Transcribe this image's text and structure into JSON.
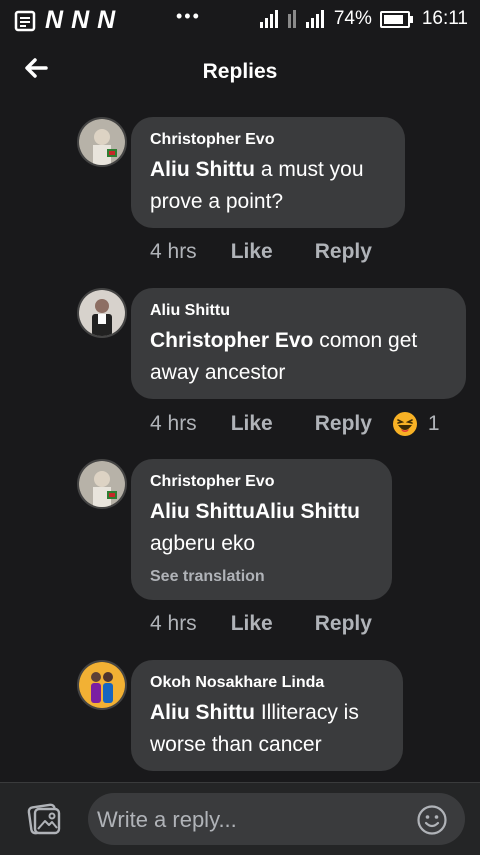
{
  "statusbar": {
    "carriers": [
      "N",
      "N",
      "N"
    ],
    "battery": "74%",
    "time": "16:11",
    "icons": [
      "notes-icon",
      "more-dots-icon",
      "signal-icon",
      "data-arrows-icon",
      "signal-hplus-icon",
      "battery-icon"
    ]
  },
  "header": {
    "title": "Replies"
  },
  "comments": [
    {
      "author": "Christopher Evo",
      "mention": "Aliu Shittu",
      "text": " a must you prove a point?",
      "time": "4 hrs",
      "like": "Like",
      "reply": "Reply"
    },
    {
      "author": "Aliu Shittu",
      "mention": "Christopher Evo",
      "text": " comon get away ancestor",
      "time": "4 hrs",
      "like": "Like",
      "reply": "Reply",
      "reaction": {
        "icon": "laughing-emoji-icon",
        "count": "1"
      }
    },
    {
      "author": "Christopher Evo",
      "mention": "Aliu ShittuAliu Shittu",
      "text": "agberu eko",
      "translate": "See translation",
      "time": "4 hrs",
      "like": "Like",
      "reply": "Reply"
    },
    {
      "author": "Okoh Nosakhare Linda",
      "mention": "Aliu Shittu",
      "text": " Illiteracy is worse than cancer"
    }
  ],
  "composer": {
    "placeholder": "Write a reply..."
  },
  "colors": {
    "background": "#19191b",
    "bubble": "#3a3b3d",
    "muted": "#b0b3b8",
    "emoji": "#f7b125"
  }
}
